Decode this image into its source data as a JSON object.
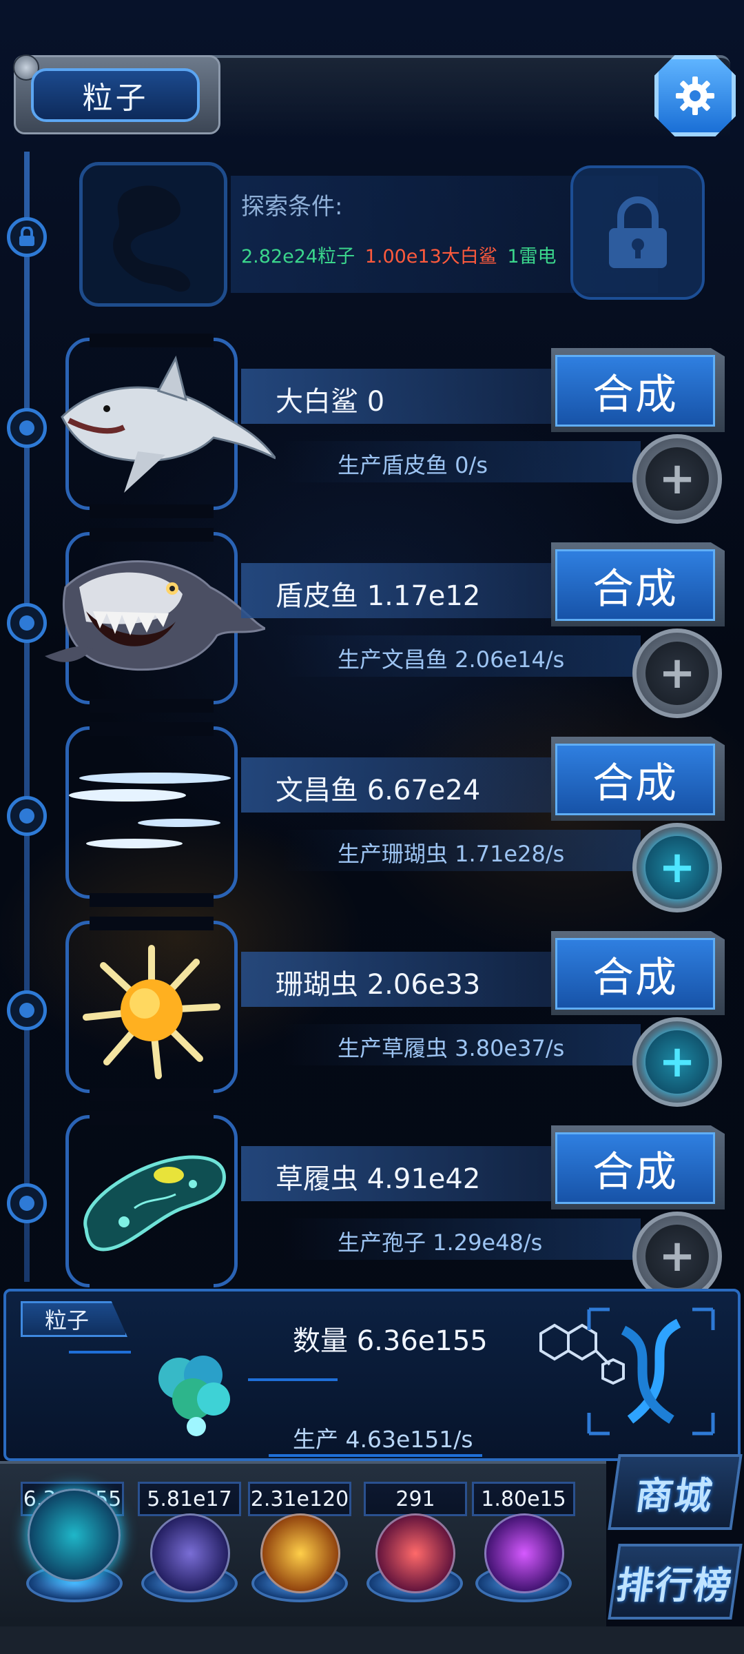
{
  "header": {
    "title": "粒子"
  },
  "locked": {
    "title": "探索条件:",
    "requirements": [
      {
        "text": "2.82e24粒子",
        "color": "#3bd68c"
      },
      {
        "text": "1.00e13大白鲨",
        "color": "#ff5a3c"
      },
      {
        "text": "1雷电",
        "color": "#3bd68c"
      }
    ]
  },
  "creatures": [
    {
      "name_label": "大白鲨 0",
      "production_label": "生产盾皮鱼 0/s",
      "synth_label": "合成",
      "plus_active": false,
      "icon": "shark"
    },
    {
      "name_label": "盾皮鱼 1.17e12",
      "production_label": "生产文昌鱼 2.06e14/s",
      "synth_label": "合成",
      "plus_active": false,
      "icon": "dunkleosteus"
    },
    {
      "name_label": "文昌鱼 6.67e24",
      "production_label": "生产珊瑚虫 1.71e28/s",
      "synth_label": "合成",
      "plus_active": true,
      "icon": "lancelet"
    },
    {
      "name_label": "珊瑚虫 2.06e33",
      "production_label": "生产草履虫 3.80e37/s",
      "synth_label": "合成",
      "plus_active": true,
      "icon": "coral-polyp"
    },
    {
      "name_label": "草履虫 4.91e42",
      "production_label": "生产孢子 1.29e48/s",
      "synth_label": "合成",
      "plus_active": false,
      "icon": "paramecium"
    }
  ],
  "particle": {
    "tab_label": "粒子",
    "quantity_label": "数量 6.36e155",
    "production_label": "生产 4.63e151/s"
  },
  "currencies": [
    {
      "value": "6.36e155",
      "icon": "particle-orb"
    },
    {
      "value": "5.81e17",
      "icon": "lightning-orb"
    },
    {
      "value": "2.31e120",
      "icon": "fire-orb"
    },
    {
      "value": "291",
      "icon": "brain-orb"
    },
    {
      "value": "1.80e15",
      "icon": "vortex-orb"
    }
  ],
  "side_buttons": {
    "shop": "商城",
    "ranking": "排行榜"
  },
  "colors": {
    "accent_blue": "#2f7fe0",
    "active_plus": "#4fe6ff",
    "requirement_green": "#3bd68c",
    "requirement_red": "#ff5a3c"
  }
}
